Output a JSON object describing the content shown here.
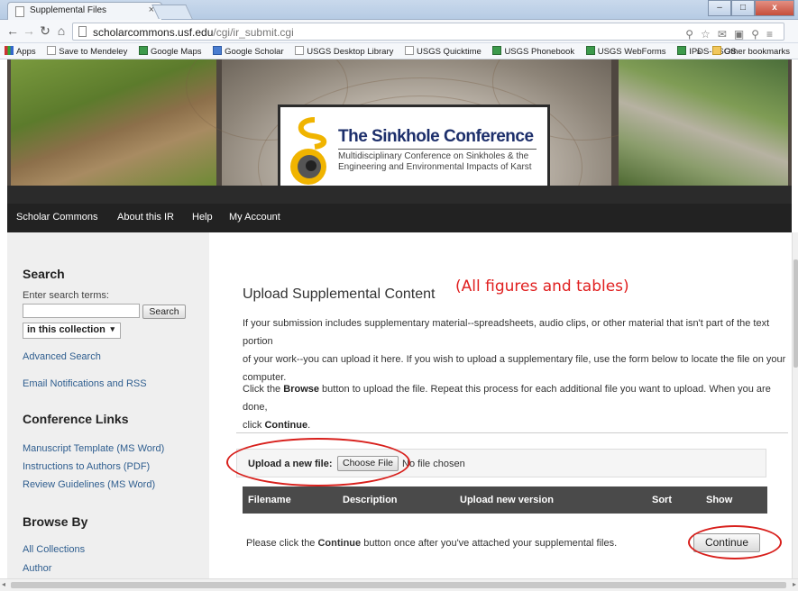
{
  "browser": {
    "tab_title": "Supplemental Files",
    "tab_close": "×",
    "url_host": "scholarcommons.usf.edu",
    "url_path": "/cgi/ir_submit.cgi",
    "bookmarks": [
      {
        "label": "Apps",
        "icon": "apps-icon"
      },
      {
        "label": "Save to Mendeley",
        "icon": "page-icon"
      },
      {
        "label": "Google Maps",
        "icon": "maps-icon"
      },
      {
        "label": "Google Scholar",
        "icon": "scholar-icon"
      },
      {
        "label": "USGS Desktop Library",
        "icon": "page-icon"
      },
      {
        "label": "USGS Quicktime",
        "icon": "page-icon"
      },
      {
        "label": "USGS Phonebook",
        "icon": "usgs-icon"
      },
      {
        "label": "USGS WebForms",
        "icon": "usgs-icon"
      },
      {
        "label": "IPDS-USGS",
        "icon": "usgs-icon"
      }
    ],
    "overflow": "»",
    "other_bookmarks": "Other bookmarks"
  },
  "banner": {
    "logo_title": "The Sinkhole Conference",
    "logo_subtitle_1": "Multidisciplinary Conference on Sinkholes & the",
    "logo_subtitle_2": "Engineering and Environmental Impacts of Karst"
  },
  "topnav": {
    "items": [
      "Scholar Commons",
      "About this IR",
      "Help",
      "My Account"
    ]
  },
  "sidebar": {
    "search_heading": "Search",
    "search_label": "Enter search terms:",
    "search_value": "",
    "search_button": "Search",
    "scope_selected": "in this collection",
    "advanced_search": "Advanced Search",
    "email_notifications": "Email Notifications and RSS",
    "conference_heading": "Conference Links",
    "conference_links": [
      "Manuscript Template (MS Word)",
      "Instructions to Authors (PDF)",
      "Review Guidelines (MS Word)"
    ],
    "browse_heading": "Browse By",
    "browse_links": [
      "All Collections",
      "Author"
    ]
  },
  "main": {
    "title": "Upload Supplemental Content",
    "annotation": "(All figures and tables)",
    "intro_line1": "If your submission includes supplementary material--spreadsheets, audio clips, or other material that isn't part of the text portion",
    "intro_line2": "of your work--you can upload it here. If you wish to upload a supplementary file, use the form below to locate the file on your",
    "intro_line3": "computer.",
    "instr_pre": "Click the ",
    "instr_browse": "Browse",
    "instr_mid": " button to upload the file. Repeat this process for each additional file you want to upload. When you are done,",
    "instr_line2_pre": "click ",
    "instr_continue": "Continue",
    "instr_line2_post": ".",
    "upload_label": "Upload a new file:",
    "choose_file": "Choose File",
    "no_file": "No file chosen",
    "table_headers": [
      "Filename",
      "Description",
      "Upload new version",
      "Sort",
      "Show"
    ],
    "footer_pre": "Please click the ",
    "footer_bold": "Continue",
    "footer_post": " button once after you've attached your supplemental files.",
    "continue_button": "Continue"
  },
  "colors": {
    "annotation_red": "#e02020",
    "link_blue": "#2f5e8f",
    "nav_bg": "#222222",
    "table_header_bg": "#4a4a4a"
  }
}
